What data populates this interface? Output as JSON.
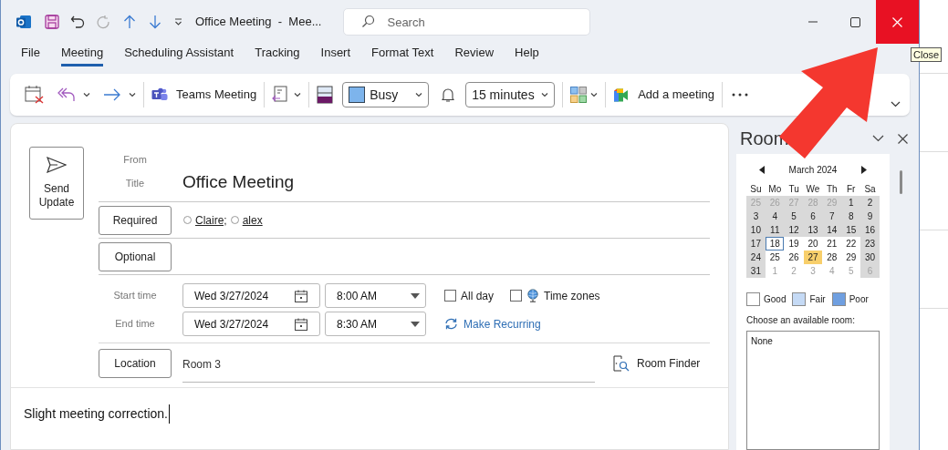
{
  "window": {
    "title": "Office Meeting  -  Mee...",
    "search_placeholder": "Search"
  },
  "tooltip": "Close",
  "menu_tabs": [
    {
      "label": "File",
      "selected": false
    },
    {
      "label": "Meeting",
      "selected": true
    },
    {
      "label": "Scheduling Assistant",
      "selected": false
    },
    {
      "label": "Tracking",
      "selected": false
    },
    {
      "label": "Insert",
      "selected": false
    },
    {
      "label": "Format Text",
      "selected": false
    },
    {
      "label": "Review",
      "selected": false
    },
    {
      "label": "Help",
      "selected": false
    }
  ],
  "ribbon": {
    "teams_button": "Teams Meeting",
    "show_as": "Busy",
    "reminder": "15 minutes",
    "add_meeting": "Add a meeting"
  },
  "form": {
    "send_button": "Send Update",
    "from_label": "From",
    "title_label": "Title",
    "title": "Office Meeting",
    "required_button": "Required",
    "attendees": [
      {
        "name": "Claire;"
      },
      {
        "name": "alex"
      }
    ],
    "optional_button": "Optional",
    "start_label": "Start time",
    "start_date": "Wed 3/27/2024",
    "start_time": "8:00 AM",
    "end_label": "End time",
    "end_date": "Wed 3/27/2024",
    "end_time": "8:30 AM",
    "options": [
      {
        "label": "All day",
        "checked": false,
        "kind": "plain"
      },
      {
        "label": "Time zones",
        "checked": false,
        "kind": "globe"
      }
    ],
    "recurring_link": "Make Recurring",
    "location_button": "Location",
    "location": "Room 3",
    "room_finder_button": "Room Finder",
    "body": "Slight meeting correction."
  },
  "room_finder": {
    "title": "Room",
    "month": "March 2024",
    "weekdays": [
      "Su",
      "Mo",
      "Tu",
      "We",
      "Th",
      "Fr",
      "Sa"
    ],
    "weeks": [
      [
        {
          "label": "25",
          "muted": true,
          "shaded": true,
          "selected": false,
          "today": false
        },
        {
          "label": "26",
          "muted": true,
          "shaded": true,
          "selected": false,
          "today": false
        },
        {
          "label": "27",
          "muted": true,
          "shaded": true,
          "selected": false,
          "today": false
        },
        {
          "label": "28",
          "muted": true,
          "shaded": true,
          "selected": false,
          "today": false
        },
        {
          "label": "29",
          "muted": true,
          "shaded": true,
          "selected": false,
          "today": false
        },
        {
          "label": "1",
          "muted": false,
          "shaded": true,
          "selected": false,
          "today": false
        },
        {
          "label": "2",
          "muted": false,
          "shaded": true,
          "selected": false,
          "today": false
        }
      ],
      [
        {
          "label": "3",
          "muted": false,
          "shaded": true,
          "selected": false,
          "today": false
        },
        {
          "label": "4",
          "muted": false,
          "shaded": true,
          "selected": false,
          "today": false
        },
        {
          "label": "5",
          "muted": false,
          "shaded": true,
          "selected": false,
          "today": false
        },
        {
          "label": "6",
          "muted": false,
          "shaded": true,
          "selected": false,
          "today": false
        },
        {
          "label": "7",
          "muted": false,
          "shaded": true,
          "selected": false,
          "today": false
        },
        {
          "label": "8",
          "muted": false,
          "shaded": true,
          "selected": false,
          "today": false
        },
        {
          "label": "9",
          "muted": false,
          "shaded": true,
          "selected": false,
          "today": false
        }
      ],
      [
        {
          "label": "10",
          "muted": false,
          "shaded": true,
          "selected": false,
          "today": false
        },
        {
          "label": "11",
          "muted": false,
          "shaded": true,
          "selected": false,
          "today": false
        },
        {
          "label": "12",
          "muted": false,
          "shaded": true,
          "selected": false,
          "today": false
        },
        {
          "label": "13",
          "muted": false,
          "shaded": true,
          "selected": false,
          "today": false
        },
        {
          "label": "14",
          "muted": false,
          "shaded": true,
          "selected": false,
          "today": false
        },
        {
          "label": "15",
          "muted": false,
          "shaded": true,
          "selected": false,
          "today": false
        },
        {
          "label": "16",
          "muted": false,
          "shaded": true,
          "selected": false,
          "today": false
        }
      ],
      [
        {
          "label": "17",
          "muted": false,
          "shaded": true,
          "selected": false,
          "today": false
        },
        {
          "label": "18",
          "muted": false,
          "shaded": false,
          "selected": false,
          "today": true
        },
        {
          "label": "19",
          "muted": false,
          "shaded": false,
          "selected": false,
          "today": false
        },
        {
          "label": "20",
          "muted": false,
          "shaded": false,
          "selected": false,
          "today": false
        },
        {
          "label": "21",
          "muted": false,
          "shaded": false,
          "selected": false,
          "today": false
        },
        {
          "label": "22",
          "muted": false,
          "shaded": false,
          "selected": false,
          "today": false
        },
        {
          "label": "23",
          "muted": false,
          "shaded": true,
          "selected": false,
          "today": false
        }
      ],
      [
        {
          "label": "24",
          "muted": false,
          "shaded": true,
          "selected": false,
          "today": false
        },
        {
          "label": "25",
          "muted": false,
          "shaded": false,
          "selected": false,
          "today": false
        },
        {
          "label": "26",
          "muted": false,
          "shaded": false,
          "selected": false,
          "today": false
        },
        {
          "label": "27",
          "muted": false,
          "shaded": false,
          "selected": true,
          "today": false
        },
        {
          "label": "28",
          "muted": false,
          "shaded": false,
          "selected": false,
          "today": false
        },
        {
          "label": "29",
          "muted": false,
          "shaded": false,
          "selected": false,
          "today": false
        },
        {
          "label": "30",
          "muted": false,
          "shaded": true,
          "selected": false,
          "today": false
        }
      ],
      [
        {
          "label": "31",
          "muted": false,
          "shaded": true,
          "selected": false,
          "today": false
        },
        {
          "label": "1",
          "muted": true,
          "shaded": false,
          "selected": false,
          "today": false
        },
        {
          "label": "2",
          "muted": true,
          "shaded": false,
          "selected": false,
          "today": false
        },
        {
          "label": "3",
          "muted": true,
          "shaded": false,
          "selected": false,
          "today": false
        },
        {
          "label": "4",
          "muted": true,
          "shaded": false,
          "selected": false,
          "today": false
        },
        {
          "label": "5",
          "muted": true,
          "shaded": false,
          "selected": false,
          "today": false
        },
        {
          "label": "6",
          "muted": true,
          "shaded": true,
          "selected": false,
          "today": false
        }
      ]
    ],
    "legend": [
      {
        "label": "Good",
        "color": "#ffffff"
      },
      {
        "label": "Fair",
        "color": "#c5daf5"
      },
      {
        "label": "Poor",
        "color": "#6f9fe0"
      }
    ],
    "rooms_label": "Choose an available room:",
    "rooms": [
      "None"
    ]
  }
}
